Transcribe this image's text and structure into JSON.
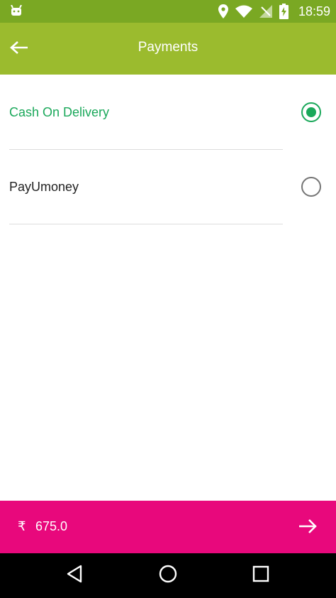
{
  "status_bar": {
    "time": "18:59",
    "icons": [
      "android-icon",
      "location-icon",
      "wifi-icon",
      "signal-icon",
      "battery-charging-icon"
    ]
  },
  "app_bar": {
    "title": "Payments",
    "back_icon": "back-arrow-icon"
  },
  "payment_options": [
    {
      "label": "Cash On Delivery",
      "selected": true
    },
    {
      "label": "PayUmoney",
      "selected": false
    }
  ],
  "bottom_bar": {
    "currency_symbol": "₹",
    "amount": "675.0",
    "next_icon": "forward-arrow-icon"
  },
  "nav_bar": {
    "icons": [
      "back-triangle-icon",
      "home-circle-icon",
      "recents-square-icon"
    ]
  },
  "colors": {
    "status_bar": "#7aa823",
    "app_bar": "#9bbb2e",
    "selected_accent": "#1aa85a",
    "bottom_bar": "#e8087c",
    "nav_bar": "#000000"
  }
}
